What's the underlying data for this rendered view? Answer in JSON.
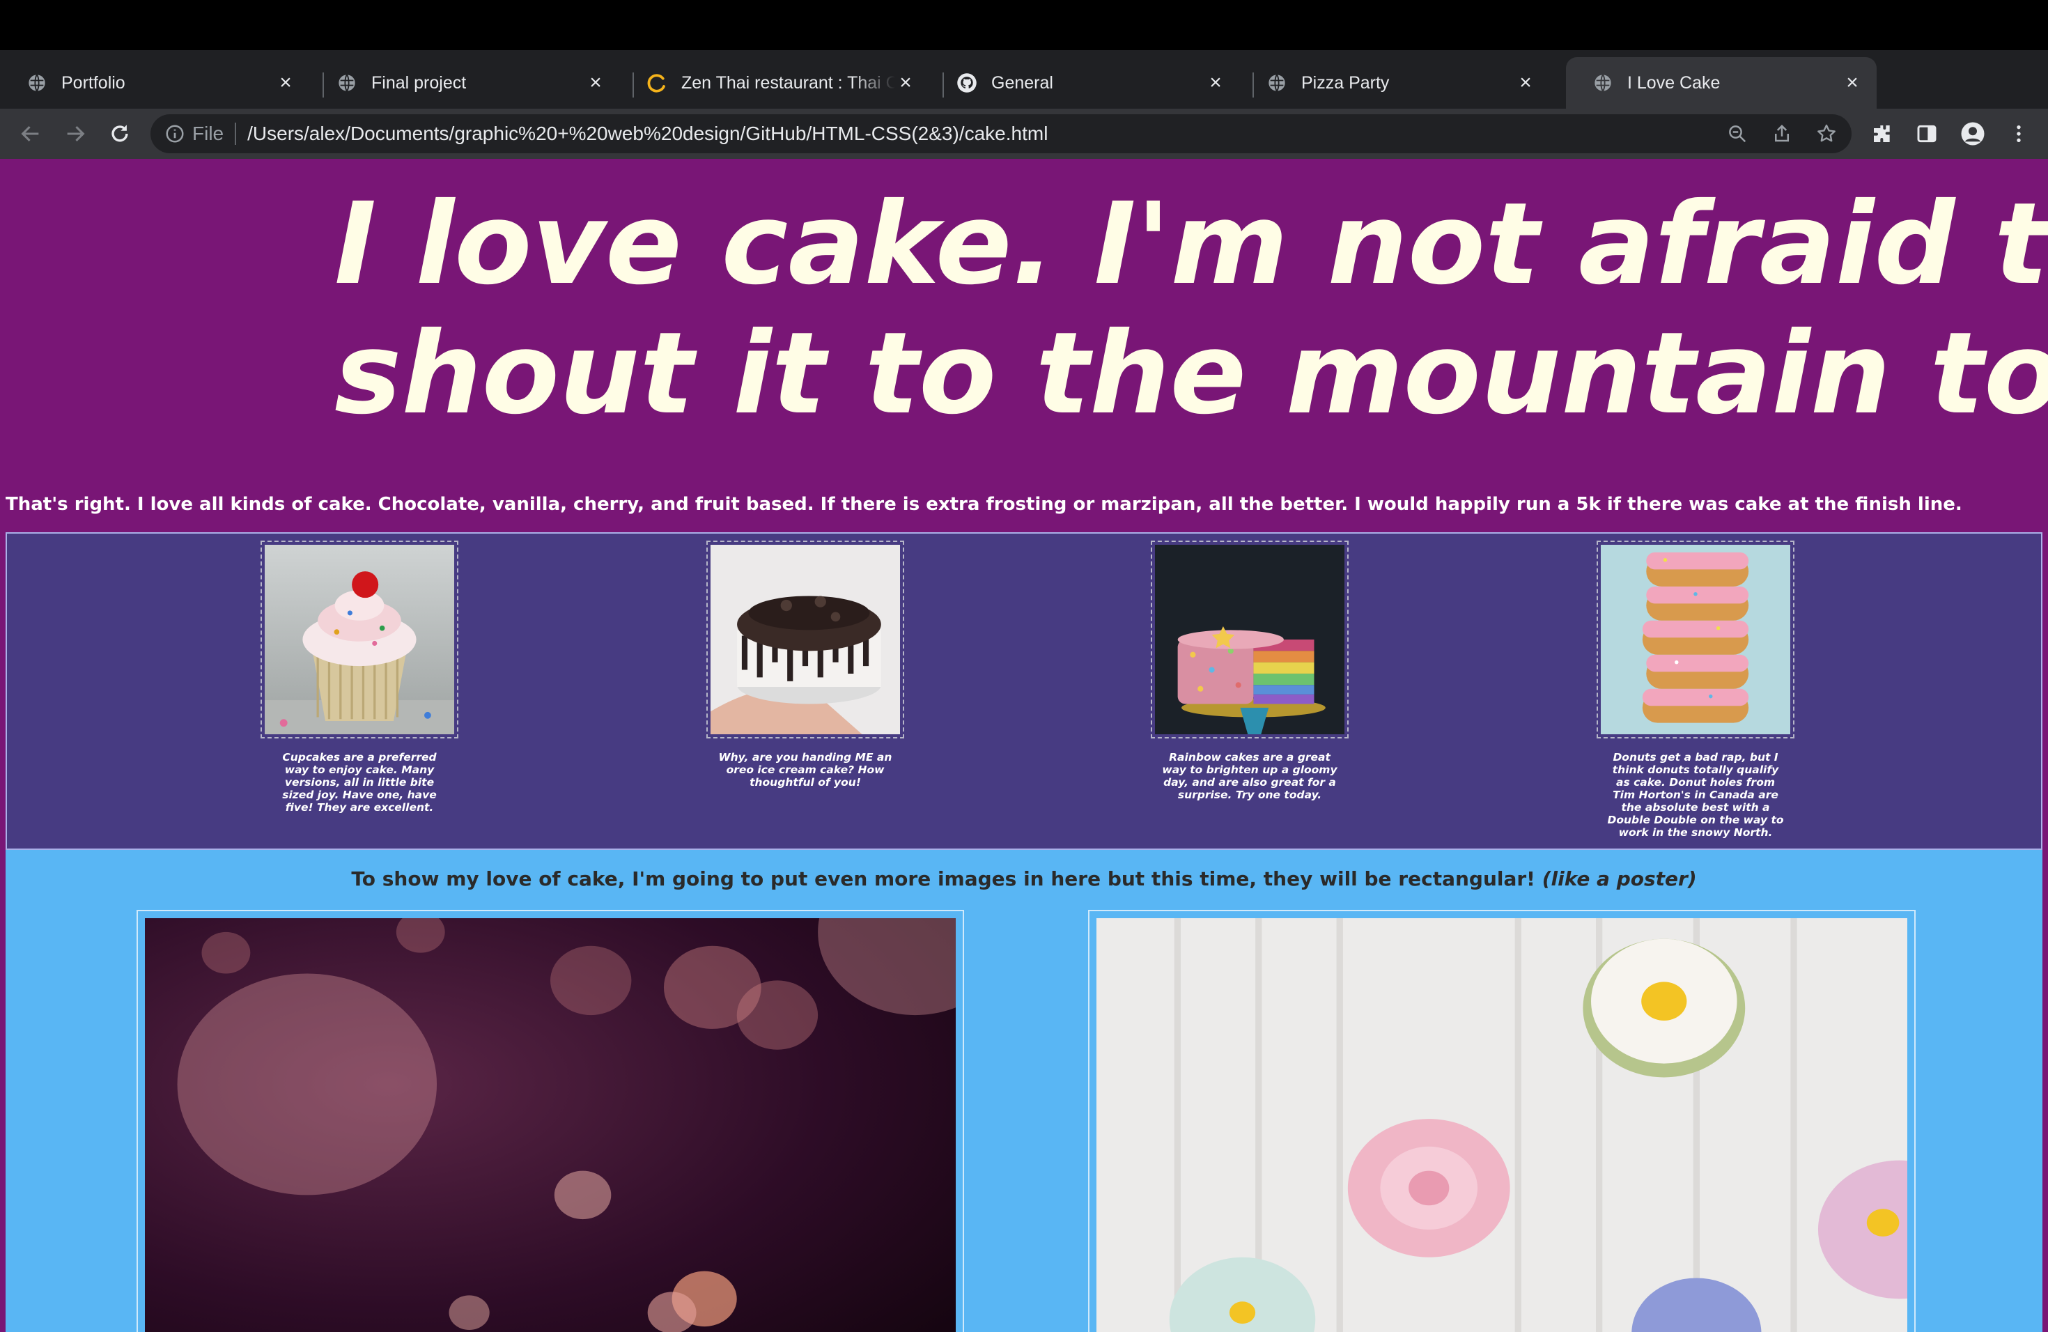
{
  "browser": {
    "tabs": [
      {
        "title": "Portfolio",
        "favicon": "globe-icon",
        "active": false
      },
      {
        "title": "Final project",
        "favicon": "globe-icon",
        "active": false
      },
      {
        "title": "Zen Thai restaurant : Thai Cuisine",
        "favicon": "loading-spinner-icon",
        "active": false
      },
      {
        "title": "General",
        "favicon": "github-icon",
        "active": false
      },
      {
        "title": "Pizza Party",
        "favicon": "globe-icon",
        "active": false
      },
      {
        "title": "I Love Cake",
        "favicon": "globe-icon",
        "active": true
      }
    ],
    "omnibox": {
      "scheme_label": "File",
      "url": "/Users/alex/Documents/graphic%20+%20web%20design/GitHub/HTML-CSS(2&3)/cake.html"
    }
  },
  "page": {
    "hero_line1": "I love cake. I'm not afraid to",
    "hero_line2": "shout it to the mountain top.",
    "intro": "That's right. I love all kinds of cake. Chocolate, vanilla, cherry, and fruit based. If there is extra frosting or marzipan, all the better. I would happily run a 5k if there was cake at the finish line.",
    "square_gallery": [
      {
        "image": "cupcake-photo",
        "caption": "Cupcakes are a preferred way to enjoy cake. Many versions, all in little bite sized joy. Have one, have five! They are excellent."
      },
      {
        "image": "oreo-cake-photo",
        "caption": "Why, are you handing ME an oreo ice cream cake? How thoughtful of you!"
      },
      {
        "image": "rainbow-cake-photo",
        "caption": "Rainbow cakes are a great way to brighten up a gloomy day, and are also great for a surprise. Try one today."
      },
      {
        "image": "donuts-photo",
        "caption": "Donuts get a bad rap, but I think donuts totally qualify as cake. Donut holes from Tim Horton's in Canada are the absolute best with a Double Double on the way to work in the snowy North."
      }
    ],
    "poster_heading": "To show my love of cake, I'm going to put even more images in here but this time, they will be rectangular!",
    "poster_heading_em": "(like a poster)",
    "posters": [
      {
        "image": "bokeh-lights-photo"
      },
      {
        "image": "flower-cupcakes-photo"
      }
    ]
  },
  "colors": {
    "page_bg": "#791676",
    "hero_text": "#fffde6",
    "gallery_bg": "#473b82",
    "poster_section_bg": "#59b6f4"
  }
}
